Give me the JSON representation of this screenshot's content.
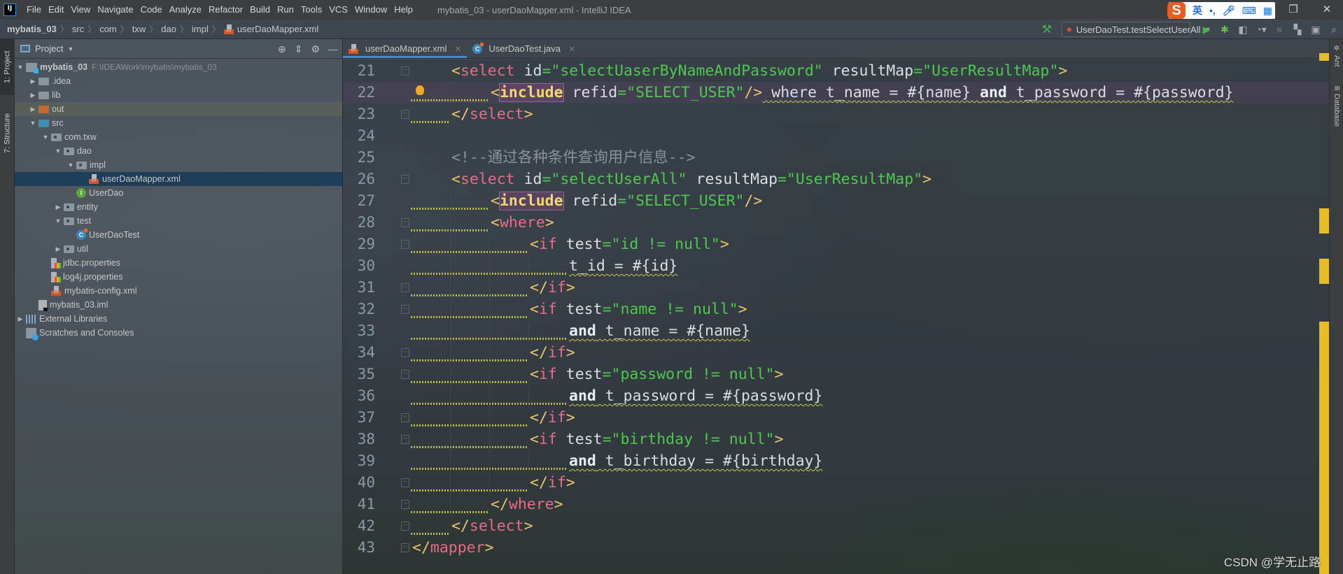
{
  "window": {
    "title": "mybatis_03 - userDaoMapper.xml - IntelliJ IDEA",
    "logo": "IJ",
    "controls": {
      "restore": "❐",
      "close": "✕"
    }
  },
  "menu": [
    "File",
    "Edit",
    "View",
    "Navigate",
    "Code",
    "Analyze",
    "Refactor",
    "Build",
    "Run",
    "Tools",
    "VCS",
    "Window",
    "Help"
  ],
  "ime": {
    "logo": "S",
    "mode": "英",
    "punct": "•,",
    "mic": "🎙",
    "keyboard": "⌨",
    "apps": "▦"
  },
  "breadcrumb": [
    "mybatis_03",
    "src",
    "com",
    "txw",
    "dao",
    "impl",
    "userDaoMapper.xml"
  ],
  "run_toolbar": {
    "build_icon": "hammer-icon",
    "config": "UserDaoTest.testSelectUserAll",
    "icons": [
      "run-icon",
      "debug-icon",
      "coverage-icon",
      "profile-icon",
      "stop-icon",
      "project-structure-icon",
      "layout-icon",
      "search-icon"
    ]
  },
  "left_strip": {
    "project_tab": "1: Project",
    "structure_tab": "7: Structure"
  },
  "project_panel": {
    "title": "Project",
    "tree": [
      {
        "label": "mybatis_03",
        "hint": "F:\\IDEAWork\\mybatis\\mybatis_03",
        "depth": 0,
        "arrow": "▼",
        "icon": "module",
        "bold": true
      },
      {
        "label": ".idea",
        "depth": 1,
        "arrow": "▶",
        "icon": "folder"
      },
      {
        "label": "lib",
        "depth": 1,
        "arrow": "▶",
        "icon": "folder"
      },
      {
        "label": "out",
        "depth": 1,
        "arrow": "▶",
        "icon": "folder-orange",
        "state": "excluded"
      },
      {
        "label": "src",
        "depth": 1,
        "arrow": "▼",
        "icon": "folder-blue"
      },
      {
        "label": "com.txw",
        "depth": 2,
        "arrow": "▼",
        "icon": "package"
      },
      {
        "label": "dao",
        "depth": 3,
        "arrow": "▼",
        "icon": "package"
      },
      {
        "label": "impl",
        "depth": 4,
        "arrow": "▼",
        "icon": "package"
      },
      {
        "label": "userDaoMapper.xml",
        "depth": 5,
        "arrow": "",
        "icon": "xml",
        "state": "selected"
      },
      {
        "label": "UserDao",
        "depth": 4,
        "arrow": "",
        "icon": "interface"
      },
      {
        "label": "entity",
        "depth": 3,
        "arrow": "▶",
        "icon": "package"
      },
      {
        "label": "test",
        "depth": 3,
        "arrow": "▼",
        "icon": "package"
      },
      {
        "label": "UserDaoTest",
        "depth": 4,
        "arrow": "",
        "icon": "class"
      },
      {
        "label": "util",
        "depth": 3,
        "arrow": "▶",
        "icon": "package"
      },
      {
        "label": "jdbc.properties",
        "depth": 2,
        "arrow": "",
        "icon": "properties"
      },
      {
        "label": "log4j.properties",
        "depth": 2,
        "arrow": "",
        "icon": "properties"
      },
      {
        "label": "mybatis-config.xml",
        "depth": 2,
        "arrow": "",
        "icon": "xml"
      },
      {
        "label": "mybatis_03.iml",
        "depth": 1,
        "arrow": "",
        "icon": "iml"
      },
      {
        "label": "External Libraries",
        "depth": 0,
        "arrow": "▶",
        "icon": "libraries"
      },
      {
        "label": "Scratches and Consoles",
        "depth": 0,
        "arrow": "",
        "icon": "scratches"
      }
    ]
  },
  "editor": {
    "tabs": [
      {
        "label": "userDaoMapper.xml",
        "icon": "xml",
        "active": true
      },
      {
        "label": "UserDaoTest.java",
        "icon": "class",
        "active": false
      }
    ],
    "current_line": 22,
    "lines": [
      {
        "n": "21",
        "indent": 1,
        "fold": "open",
        "tokens": [
          [
            "t-br",
            "<"
          ],
          [
            "t-tag",
            "select"
          ],
          [
            "t-attr",
            " id"
          ],
          [
            "t-str",
            "=\"selectUaserByNameAndPassword\""
          ],
          [
            "t-attr",
            " resultMap"
          ],
          [
            "t-str",
            "=\"UserResultMap\""
          ],
          [
            "t-br",
            ">"
          ]
        ]
      },
      {
        "n": "22",
        "indent": 2,
        "bulb": true,
        "squig": 2,
        "tokens": [
          [
            "t-br",
            "<"
          ],
          [
            "t-inc",
            "include"
          ],
          [
            "t-attr",
            " refid"
          ],
          [
            "t-str",
            "=\"SELECT_USER\""
          ],
          [
            "t-br",
            "/>"
          ],
          [
            "u",
            " where t_name = #{name} "
          ],
          [
            "u t-kw",
            "and"
          ],
          [
            "u",
            " t_password = #{password}"
          ]
        ]
      },
      {
        "n": "23",
        "indent": 1,
        "fold": "close",
        "squig": 1,
        "tokens": [
          [
            "t-br",
            "</"
          ],
          [
            "t-tag",
            "select"
          ],
          [
            "t-br",
            ">"
          ]
        ]
      },
      {
        "n": "24",
        "indent": 0,
        "tokens": []
      },
      {
        "n": "25",
        "indent": 1,
        "tokens": [
          [
            "t-cmt",
            "<!--通过各种条件查询用户信息-->"
          ]
        ]
      },
      {
        "n": "26",
        "indent": 1,
        "fold": "open",
        "tokens": [
          [
            "t-br",
            "<"
          ],
          [
            "t-tag",
            "select"
          ],
          [
            "t-attr",
            " id"
          ],
          [
            "t-str",
            "=\"selectUserAll\""
          ],
          [
            "t-attr",
            " resultMap"
          ],
          [
            "t-str",
            "=\"UserResultMap\""
          ],
          [
            "t-br",
            ">"
          ]
        ]
      },
      {
        "n": "27",
        "indent": 2,
        "squig": 2,
        "tokens": [
          [
            "t-br",
            "<"
          ],
          [
            "t-inc",
            "include"
          ],
          [
            "t-attr",
            " refid"
          ],
          [
            "t-str",
            "=\"SELECT_USER\""
          ],
          [
            "t-br",
            "/>"
          ]
        ]
      },
      {
        "n": "28",
        "indent": 2,
        "fold": "open",
        "squig": 2,
        "tokens": [
          [
            "t-br",
            "<"
          ],
          [
            "t-tag",
            "where"
          ],
          [
            "t-br",
            ">"
          ]
        ]
      },
      {
        "n": "29",
        "indent": 3,
        "fold": "open",
        "squig": 3,
        "tokens": [
          [
            "t-br",
            "<"
          ],
          [
            "t-tag",
            "if"
          ],
          [
            "t-attr",
            " test"
          ],
          [
            "t-str",
            "=\"id != null\""
          ],
          [
            "t-br",
            ">"
          ]
        ]
      },
      {
        "n": "30",
        "indent": 4,
        "squig": 4,
        "tokens": [
          [
            "u",
            "t_id = #{id}"
          ]
        ]
      },
      {
        "n": "31",
        "indent": 3,
        "fold": "close",
        "squig": 3,
        "tokens": [
          [
            "t-br",
            "</"
          ],
          [
            "t-tag",
            "if"
          ],
          [
            "t-br",
            ">"
          ]
        ]
      },
      {
        "n": "32",
        "indent": 3,
        "fold": "open",
        "squig": 3,
        "tokens": [
          [
            "t-br",
            "<"
          ],
          [
            "t-tag",
            "if"
          ],
          [
            "t-attr",
            " test"
          ],
          [
            "t-str",
            "=\"name != null\""
          ],
          [
            "t-br",
            ">"
          ]
        ]
      },
      {
        "n": "33",
        "indent": 4,
        "squig": 4,
        "tokens": [
          [
            "u t-kw",
            "and"
          ],
          [
            "u",
            " t_name = #{name}"
          ]
        ]
      },
      {
        "n": "34",
        "indent": 3,
        "fold": "close",
        "squig": 3,
        "tokens": [
          [
            "t-br",
            "</"
          ],
          [
            "t-tag",
            "if"
          ],
          [
            "t-br",
            ">"
          ]
        ]
      },
      {
        "n": "35",
        "indent": 3,
        "fold": "open",
        "squig": 3,
        "tokens": [
          [
            "t-br",
            "<"
          ],
          [
            "t-tag",
            "if"
          ],
          [
            "t-attr",
            " test"
          ],
          [
            "t-str",
            "=\"password != null\""
          ],
          [
            "t-br",
            ">"
          ]
        ]
      },
      {
        "n": "36",
        "indent": 4,
        "squig": 4,
        "tokens": [
          [
            "u t-kw",
            "and"
          ],
          [
            "u",
            " t_password = #{password}"
          ]
        ]
      },
      {
        "n": "37",
        "indent": 3,
        "fold": "close",
        "squig": 3,
        "tokens": [
          [
            "t-br",
            "</"
          ],
          [
            "t-tag",
            "if"
          ],
          [
            "t-br",
            ">"
          ]
        ]
      },
      {
        "n": "38",
        "indent": 3,
        "fold": "open",
        "squig": 3,
        "tokens": [
          [
            "t-br",
            "<"
          ],
          [
            "t-tag",
            "if"
          ],
          [
            "t-attr",
            " test"
          ],
          [
            "t-str",
            "=\"birthday != null\""
          ],
          [
            "t-br",
            ">"
          ]
        ]
      },
      {
        "n": "39",
        "indent": 4,
        "squig": 4,
        "tokens": [
          [
            "u t-kw",
            "and"
          ],
          [
            "u",
            " t_birthday = #{birthday}"
          ]
        ]
      },
      {
        "n": "40",
        "indent": 3,
        "fold": "close",
        "squig": 3,
        "tokens": [
          [
            "t-br",
            "</"
          ],
          [
            "t-tag",
            "if"
          ],
          [
            "t-br",
            ">"
          ]
        ]
      },
      {
        "n": "41",
        "indent": 2,
        "fold": "close",
        "squig": 2,
        "tokens": [
          [
            "t-br",
            "</"
          ],
          [
            "t-tag",
            "where"
          ],
          [
            "t-br",
            ">"
          ]
        ]
      },
      {
        "n": "42",
        "indent": 1,
        "fold": "close",
        "squig": 1,
        "tokens": [
          [
            "t-br",
            "</"
          ],
          [
            "t-tag",
            "select"
          ],
          [
            "t-br",
            ">"
          ]
        ]
      },
      {
        "n": "43",
        "indent": 0,
        "fold": "close",
        "tokens": [
          [
            "t-br",
            "</"
          ],
          [
            "t-tag",
            "mapper"
          ],
          [
            "t-br",
            ">"
          ]
        ]
      }
    ]
  },
  "right_strip": {
    "ant_tab": "Ant",
    "database_tab": "Database"
  },
  "colors": {
    "warning_mark": "#e6be23",
    "selection": "#1e3d58",
    "tab_underline": "#4a88c7",
    "tag": "#e96b8a",
    "string": "#4fc850"
  },
  "watermark": "CSDN @学无止路"
}
